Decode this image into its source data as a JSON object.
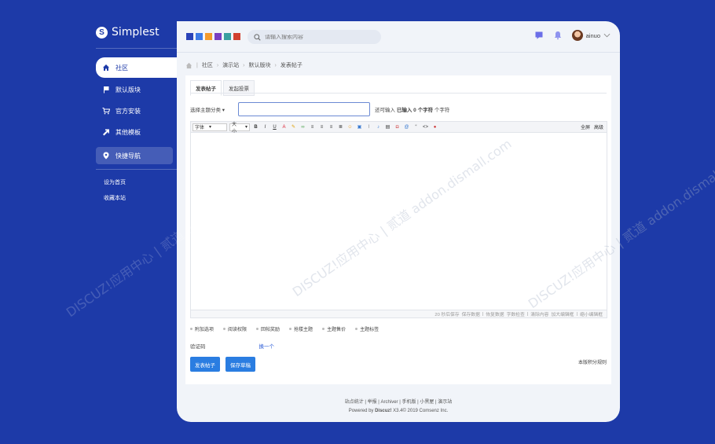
{
  "brand": {
    "logo_letter": "S",
    "name": "Simplest"
  },
  "sidebar": {
    "items": [
      {
        "label": "社区",
        "icon": "home-icon"
      },
      {
        "label": "默认版块",
        "icon": "flag-icon"
      },
      {
        "label": "官方安装",
        "icon": "cart-icon"
      },
      {
        "label": "其他模板",
        "icon": "arrow-icon"
      },
      {
        "label": "快捷导航",
        "icon": "location-icon"
      }
    ],
    "links": [
      "设为首页",
      "收藏本站"
    ]
  },
  "topbar": {
    "swatches": [
      "#2a43b8",
      "#3d7be6",
      "#f39a2b",
      "#7a3fc2",
      "#3aa0a0",
      "#d2412f"
    ],
    "search_placeholder": "请输入搜索内容",
    "username": "ainuo"
  },
  "breadcrumb": [
    "社区",
    "演示站",
    "默认版块",
    "发表帖子"
  ],
  "tabs": [
    "发表帖子",
    "发起投票"
  ],
  "form": {
    "type_select": "选择主题分类",
    "remain_prefix": "还可输入",
    "remain_entered": "已输入",
    "remain_count": "0",
    "remain_unit": "个字符",
    "remain_tail": "个字符",
    "toolbar_font": "字体",
    "toolbar_size": "大小",
    "toolbar_fullscreen": "全屏",
    "toolbar_advanced": "高级",
    "status_items": [
      "20 秒后保存",
      "保存数据",
      "恢复数据",
      "字数检查",
      "清除内容",
      "加大编辑框",
      "缩小编辑框"
    ],
    "options": [
      "附加选项",
      "阅读权限",
      "回帖奖励",
      "抢楼主题",
      "主题售价",
      "主题标签"
    ],
    "captcha_label": "验证码",
    "captcha_change": "换一个",
    "submit": "发表帖子",
    "save_draft": "保存草稿",
    "rules": "本版积分规则"
  },
  "footer": {
    "links": [
      "站点统计",
      "举报",
      "Archiver",
      "手机版",
      "小黑屋",
      "演示站"
    ],
    "powered_prefix": "Powered by",
    "powered_brand": "Discuz!",
    "powered_version": "X3.4",
    "copyright": "© 2019 Comsenz Inc."
  },
  "watermark": "DISCUZ!应用中心 | 贰道 addon.dismall.com"
}
